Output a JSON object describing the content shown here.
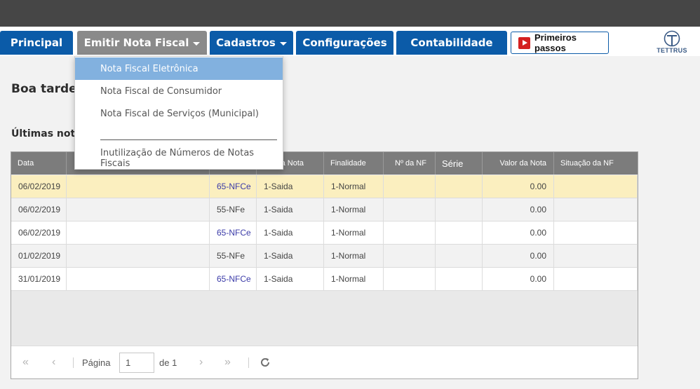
{
  "nav": {
    "principal": "Principal",
    "emitir": "Emitir Nota Fiscal",
    "cadastros": "Cadastros",
    "configuracoes": "Configurações",
    "contabilidade": "Contabilidade",
    "primeiros_passos": "Primeiros passos",
    "logo_text": "TETTRUS"
  },
  "dropdown": {
    "items": [
      "Nota Fiscal Eletrônica",
      "Nota Fiscal de Consumidor",
      "Nota Fiscal de Serviços (Municipal)",
      "Inutilização de Números de Notas Fiscais"
    ]
  },
  "main": {
    "greeting": "Boa tarde Bi",
    "recent_title": "Últimas notas"
  },
  "table": {
    "columns": [
      "Data",
      "",
      "",
      "a Nota",
      "Finalidade",
      "Nº da NF",
      "Série",
      "Valor da Nota",
      "Situação da NF"
    ],
    "rows": [
      {
        "data": "06/02/2019",
        "cliente": "",
        "modelo": "65-NFCe",
        "tipo": "1-Saida",
        "finalidade": "1-Normal",
        "numero": "",
        "serie": "",
        "valor": "0.00",
        "situacao": ""
      },
      {
        "data": "06/02/2019",
        "cliente": "",
        "modelo": "55-NFe",
        "tipo": "1-Saida",
        "finalidade": "1-Normal",
        "numero": "",
        "serie": "",
        "valor": "0.00",
        "situacao": ""
      },
      {
        "data": "06/02/2019",
        "cliente": "",
        "modelo": "65-NFCe",
        "tipo": "1-Saida",
        "finalidade": "1-Normal",
        "numero": "",
        "serie": "",
        "valor": "0.00",
        "situacao": ""
      },
      {
        "data": "01/02/2019",
        "cliente": "",
        "modelo": "55-NFe",
        "tipo": "1-Saida",
        "finalidade": "1-Normal",
        "numero": "",
        "serie": "",
        "valor": "0.00",
        "situacao": ""
      },
      {
        "data": "31/01/2019",
        "cliente": "",
        "modelo": "65-NFCe",
        "tipo": "1-Saida",
        "finalidade": "1-Normal",
        "numero": "",
        "serie": "",
        "valor": "0.00",
        "situacao": ""
      }
    ]
  },
  "pager": {
    "page_label": "Página",
    "page_value": "1",
    "of_label": "de 1"
  },
  "colors": {
    "nav_blue": "#0b5ba8",
    "nav_active": "#8a8a8a",
    "selected_row": "#fbefbf",
    "dropdown_highlight": "#82b1df",
    "link": "#3b3ba8"
  },
  "icons": [
    "play-icon",
    "first-page-icon",
    "prev-page-icon",
    "next-page-icon",
    "last-page-icon",
    "refresh-icon",
    "tettrus-logo-icon"
  ]
}
